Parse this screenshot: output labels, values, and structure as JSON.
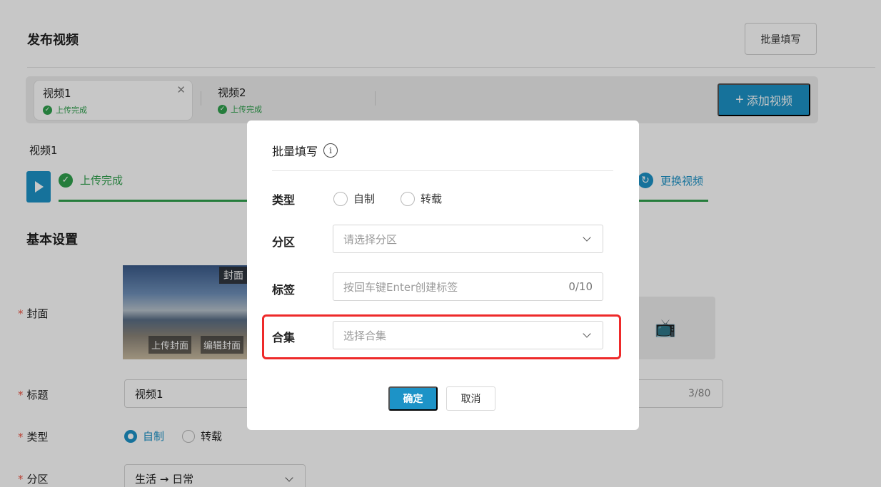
{
  "page": {
    "title": "发布视频",
    "batch_fill_label": "批量填写",
    "tabs": [
      {
        "name": "视频1",
        "status": "上传完成",
        "active": true
      },
      {
        "name": "视频2",
        "status": "上传完成",
        "active": false
      }
    ],
    "add_video_label": "添加视频",
    "current_video_label": "视频1",
    "upload_status": "上传完成",
    "replace_video_label": "更换视频",
    "basic_settings_title": "基本设置",
    "cover": {
      "label": "封面",
      "tag": "封面",
      "upload_label": "上传封面",
      "edit_label": "编辑封面"
    },
    "title_field": {
      "label": "标题",
      "value": "视频1",
      "count": "3/80"
    },
    "type_field": {
      "label": "类型",
      "options": [
        "自制",
        "转载"
      ],
      "selected": "自制"
    },
    "area_field": {
      "label": "分区",
      "value": "生活 → 日常"
    },
    "required_mark": "*"
  },
  "modal": {
    "title": "批量填写",
    "info_glyph": "i",
    "type": {
      "label": "类型",
      "options": [
        "自制",
        "转载"
      ]
    },
    "area": {
      "label": "分区",
      "placeholder": "请选择分区"
    },
    "tags": {
      "label": "标签",
      "placeholder": "按回车键Enter创建标签",
      "count": "0/10"
    },
    "collection": {
      "label": "合集",
      "placeholder": "选择合集"
    },
    "confirm_label": "确定",
    "cancel_label": "取消"
  },
  "colors": {
    "accent": "#1d93c7",
    "success": "#30a14e",
    "highlight": "#ee2a2a"
  },
  "icons": [
    "close-icon",
    "check-circle-icon",
    "plus-icon",
    "video-file-icon",
    "refresh-icon",
    "tv-icon",
    "info-icon",
    "chevron-down-icon"
  ]
}
